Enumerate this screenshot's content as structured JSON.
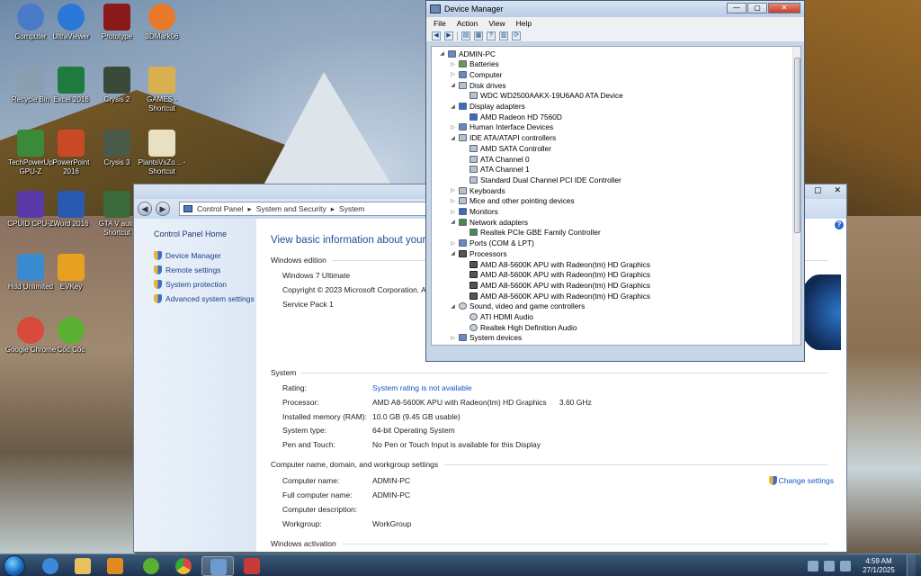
{
  "desktop": {
    "icons": [
      {
        "label": "Computer",
        "icon": "computer-icon"
      },
      {
        "label": "UltraViewer",
        "icon": "ultraviewer-icon"
      },
      {
        "label": "Prototype",
        "icon": "prototype-icon"
      },
      {
        "label": "3DMark06",
        "icon": "3dmark-icon"
      },
      {
        "label": "Recycle Bin",
        "icon": "recycle-bin-icon"
      },
      {
        "label": "Excel 2016",
        "icon": "excel-icon"
      },
      {
        "label": "Crysis 2",
        "icon": "crysis2-icon"
      },
      {
        "label": "GAMES - Shortcut",
        "icon": "folder-icon"
      },
      {
        "label": "TechPowerUp GPU-Z",
        "icon": "gpuz-icon"
      },
      {
        "label": "PowerPoint 2016",
        "icon": "powerpoint-icon"
      },
      {
        "label": "Crysis 3",
        "icon": "crysis3-icon"
      },
      {
        "label": "PlantsVsZo... - Shortcut",
        "icon": "plants-vs-zombies-icon"
      },
      {
        "label": "CPUID CPU-Z",
        "icon": "cpuz-icon"
      },
      {
        "label": "Word 2016",
        "icon": "word-icon"
      },
      {
        "label": "GTA V auto Shortcut",
        "icon": "gta-icon"
      },
      {
        "label": "Hdd Unlimited",
        "icon": "hdd-icon"
      },
      {
        "label": "EVKey",
        "icon": "evkey-icon"
      },
      {
        "label": "Google Chrome",
        "icon": "chrome-icon"
      },
      {
        "label": "Cốc Cốc",
        "icon": "coccoc-icon"
      }
    ]
  },
  "control_panel": {
    "breadcrumb": [
      "Control Panel",
      "System and Security",
      "System"
    ],
    "sidebar": {
      "home": "Control Panel Home",
      "links": [
        "Device Manager",
        "Remote settings",
        "System protection",
        "Advanced system settings"
      ]
    },
    "title": "View basic information about your co",
    "windows_edition": {
      "header": "Windows edition",
      "edition": "Windows 7 Ultimate",
      "copyright": "Copyright © 2023 Microsoft Corporation. All",
      "service_pack": "Service Pack 1"
    },
    "system": {
      "header": "System",
      "rows": [
        {
          "k": "Rating:",
          "v": "System rating is not available",
          "link": true
        },
        {
          "k": "Processor:",
          "v": "AMD A8-5600K APU with Radeon(tm) HD Graphics      3.60 GHz",
          "link": false
        },
        {
          "k": "Installed memory (RAM):",
          "v": "10.0 GB (9.45 GB usable)",
          "link": false
        },
        {
          "k": "System type:",
          "v": "64-bit Operating System",
          "link": false
        },
        {
          "k": "Pen and Touch:",
          "v": "No Pen or Touch Input is available for this Display",
          "link": false
        }
      ]
    },
    "computer_name": {
      "header": "Computer name, domain, and workgroup settings",
      "change": "Change settings",
      "rows": [
        {
          "k": "Computer name:",
          "v": "ADMIN-PC"
        },
        {
          "k": "Full computer name:",
          "v": "ADMIN-PC"
        },
        {
          "k": "Computer description:",
          "v": ""
        },
        {
          "k": "Workgroup:",
          "v": "WorkGroup"
        }
      ]
    },
    "activation": {
      "header": "Windows activation"
    }
  },
  "device_manager": {
    "title": "Device Manager",
    "menu": [
      "File",
      "Action",
      "View",
      "Help"
    ],
    "tree": [
      {
        "level": 0,
        "toggle": "◢",
        "icon": "pc",
        "label": "ADMIN-PC"
      },
      {
        "level": 1,
        "toggle": "▷",
        "icon": "batt",
        "label": "Batteries"
      },
      {
        "level": 1,
        "toggle": "▷",
        "icon": "pc",
        "label": "Computer"
      },
      {
        "level": 1,
        "toggle": "◢",
        "icon": "disk",
        "label": "Disk drives"
      },
      {
        "level": 2,
        "toggle": "",
        "icon": "disk",
        "label": "WDC WD2500AAKX-19U6AA0 ATA Device"
      },
      {
        "level": 1,
        "toggle": "◢",
        "icon": "monitor",
        "label": "Display adapters"
      },
      {
        "level": 2,
        "toggle": "",
        "icon": "monitor",
        "label": "AMD Radeon HD 7560D"
      },
      {
        "level": 1,
        "toggle": "▷",
        "icon": "pc",
        "label": "Human Interface Devices"
      },
      {
        "level": 1,
        "toggle": "◢",
        "icon": "disk",
        "label": "IDE ATA/ATAPI controllers"
      },
      {
        "level": 2,
        "toggle": "",
        "icon": "disk",
        "label": "AMD SATA Controller"
      },
      {
        "level": 2,
        "toggle": "",
        "icon": "disk",
        "label": "ATA Channel 0"
      },
      {
        "level": 2,
        "toggle": "",
        "icon": "disk",
        "label": "ATA Channel 1"
      },
      {
        "level": 2,
        "toggle": "",
        "icon": "disk",
        "label": "Standard Dual Channel PCI IDE Controller"
      },
      {
        "level": 1,
        "toggle": "▷",
        "icon": "disk",
        "label": "Keyboards"
      },
      {
        "level": 1,
        "toggle": "▷",
        "icon": "disk",
        "label": "Mice and other pointing devices"
      },
      {
        "level": 1,
        "toggle": "▷",
        "icon": "monitor",
        "label": "Monitors"
      },
      {
        "level": 1,
        "toggle": "◢",
        "icon": "net",
        "label": "Network adapters"
      },
      {
        "level": 2,
        "toggle": "",
        "icon": "net",
        "label": "Realtek PCIe GBE Family Controller"
      },
      {
        "level": 1,
        "toggle": "▷",
        "icon": "pc",
        "label": "Ports (COM & LPT)"
      },
      {
        "level": 1,
        "toggle": "◢",
        "icon": "chip",
        "label": "Processors"
      },
      {
        "level": 2,
        "toggle": "",
        "icon": "chip",
        "label": "AMD A8-5600K APU with Radeon(tm) HD Graphics"
      },
      {
        "level": 2,
        "toggle": "",
        "icon": "chip",
        "label": "AMD A8-5600K APU with Radeon(tm) HD Graphics"
      },
      {
        "level": 2,
        "toggle": "",
        "icon": "chip",
        "label": "AMD A8-5600K APU with Radeon(tm) HD Graphics"
      },
      {
        "level": 2,
        "toggle": "",
        "icon": "chip",
        "label": "AMD A8-5600K APU with Radeon(tm) HD Graphics"
      },
      {
        "level": 1,
        "toggle": "◢",
        "icon": "sound",
        "label": "Sound, video and game controllers"
      },
      {
        "level": 2,
        "toggle": "",
        "icon": "sound",
        "label": "ATI HDMI Audio"
      },
      {
        "level": 2,
        "toggle": "",
        "icon": "sound",
        "label": "Realtek High Definition Audio"
      },
      {
        "level": 1,
        "toggle": "▷",
        "icon": "pc",
        "label": "System devices"
      }
    ]
  },
  "taskbar": {
    "time": "4:59 AM",
    "date": "27/1/2025"
  }
}
